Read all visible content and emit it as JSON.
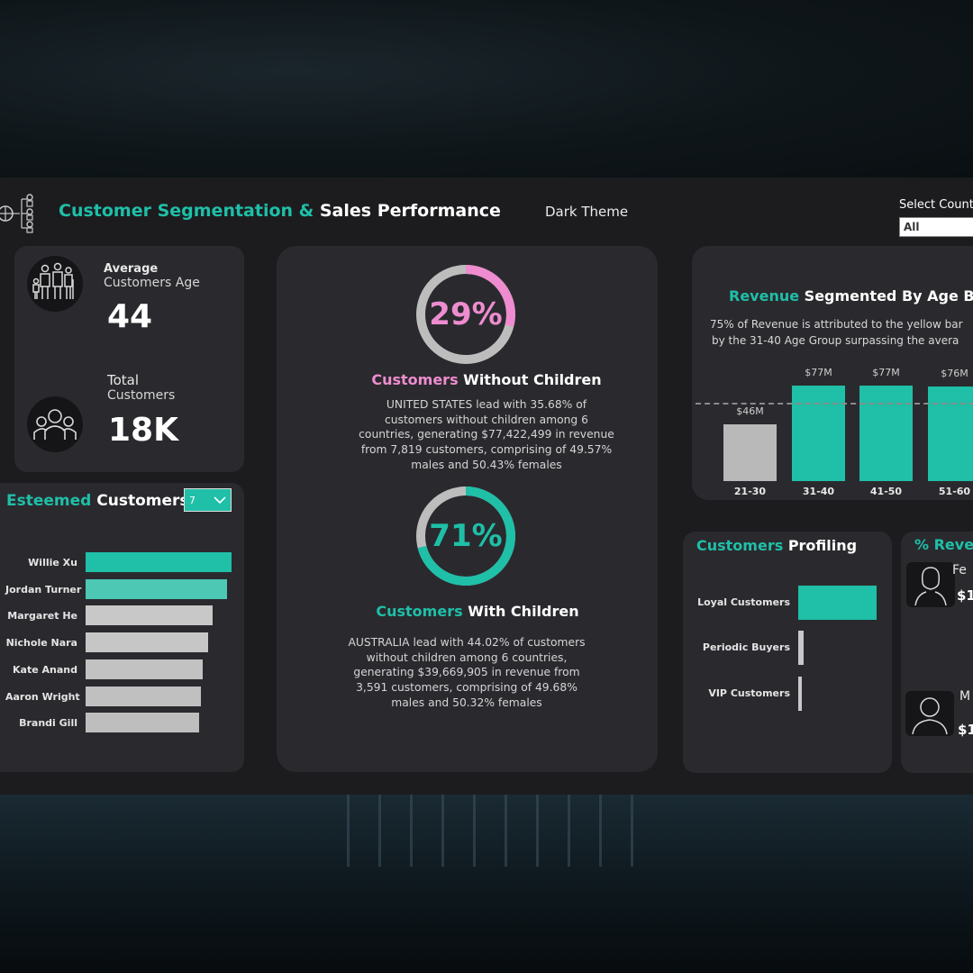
{
  "header": {
    "title_part1": "Customer Segmentation",
    "title_amp": "&",
    "title_part2": "Sales Performance",
    "theme_label": "Dark Theme",
    "country_filter_label": "Select Count",
    "country_filter_value": "All"
  },
  "kpis": {
    "avg_age_label_line1": "Average",
    "avg_age_label_line2": "Customers Age",
    "avg_age_value": "44",
    "total_label_line1": "Total",
    "total_label_line2": "Customers",
    "total_value": "18K"
  },
  "esteemed": {
    "title_part1": "Esteemed",
    "title_part2": "Customers",
    "top_n_value": "7",
    "chart_data": {
      "type": "bar",
      "orientation": "horizontal",
      "categories": [
        "Willie Xu",
        "Jordan Turner",
        "Margaret He",
        "Nichole Nara",
        "Kate Anand",
        "Aaron Wright",
        "Brandi Gill"
      ],
      "values": [
        1.0,
        0.97,
        0.87,
        0.84,
        0.8,
        0.79,
        0.78
      ],
      "colors": [
        "#1fbfa8",
        "#4cc8b5",
        "#c8c8c8",
        "#c6c6c6",
        "#c2c2c2",
        "#c0c0c0",
        "#bebebe"
      ]
    }
  },
  "children": {
    "without_pct": "29%",
    "without_fraction": 0.29,
    "without_title_part1": "Customers",
    "without_title_part2": "Without Children",
    "without_desc": "UNITED STATES lead with 35.68% of customers without children among 6 countries, generating $77,422,499 in revenue from 7,819 customers, comprising of 49.57% males and 50.43% females",
    "with_pct": "71%",
    "with_fraction": 0.71,
    "with_title_part1": "Customers",
    "with_title_part2": "With Children",
    "with_desc": "AUSTRALIA lead with 44.02% of customers without children among 6 countries, generating $39,669,905 in revenue from 3,591 customers, comprising of 49.68% males and 50.32% females",
    "colors": {
      "pink": "#ee8ccf",
      "teal": "#1fbfa8",
      "track": "#bdbdbd"
    }
  },
  "revenue": {
    "title_part1": "Revenue",
    "title_part2": "Segmented By Age Bra",
    "subtitle_line1": "75% of Revenue is attributed to the yellow bar",
    "subtitle_line2": "by the 31-40 Age Group surpassing the avera",
    "chart_data": {
      "type": "bar",
      "categories": [
        "21-30",
        "31-40",
        "41-50",
        "51-60"
      ],
      "values": [
        46,
        77,
        77,
        76
      ],
      "value_labels": [
        "$46M",
        "$77M",
        "$77M",
        "$76M"
      ],
      "unit": "$M",
      "average_line": 63,
      "ylim": [
        0,
        80
      ],
      "colors": [
        "#b9b9b9",
        "#1fbfa8",
        "#1fbfa8",
        "#1fbfa8"
      ]
    }
  },
  "profiling": {
    "title_part1": "Customers",
    "title_part2": "Profiling",
    "chart_data": {
      "type": "bar",
      "orientation": "horizontal",
      "categories": [
        "Loyal Customers",
        "Periodic Buyers",
        "VIP Customers"
      ],
      "values": [
        1.0,
        0.07,
        0.05
      ],
      "colors": [
        "#1fbfa8",
        "#c8c8c8",
        "#c8c8c8"
      ]
    }
  },
  "rev_gender": {
    "title": "% Reve",
    "female_label": "Fe",
    "female_value": "$1",
    "male_label": "M",
    "male_value": "$1"
  }
}
